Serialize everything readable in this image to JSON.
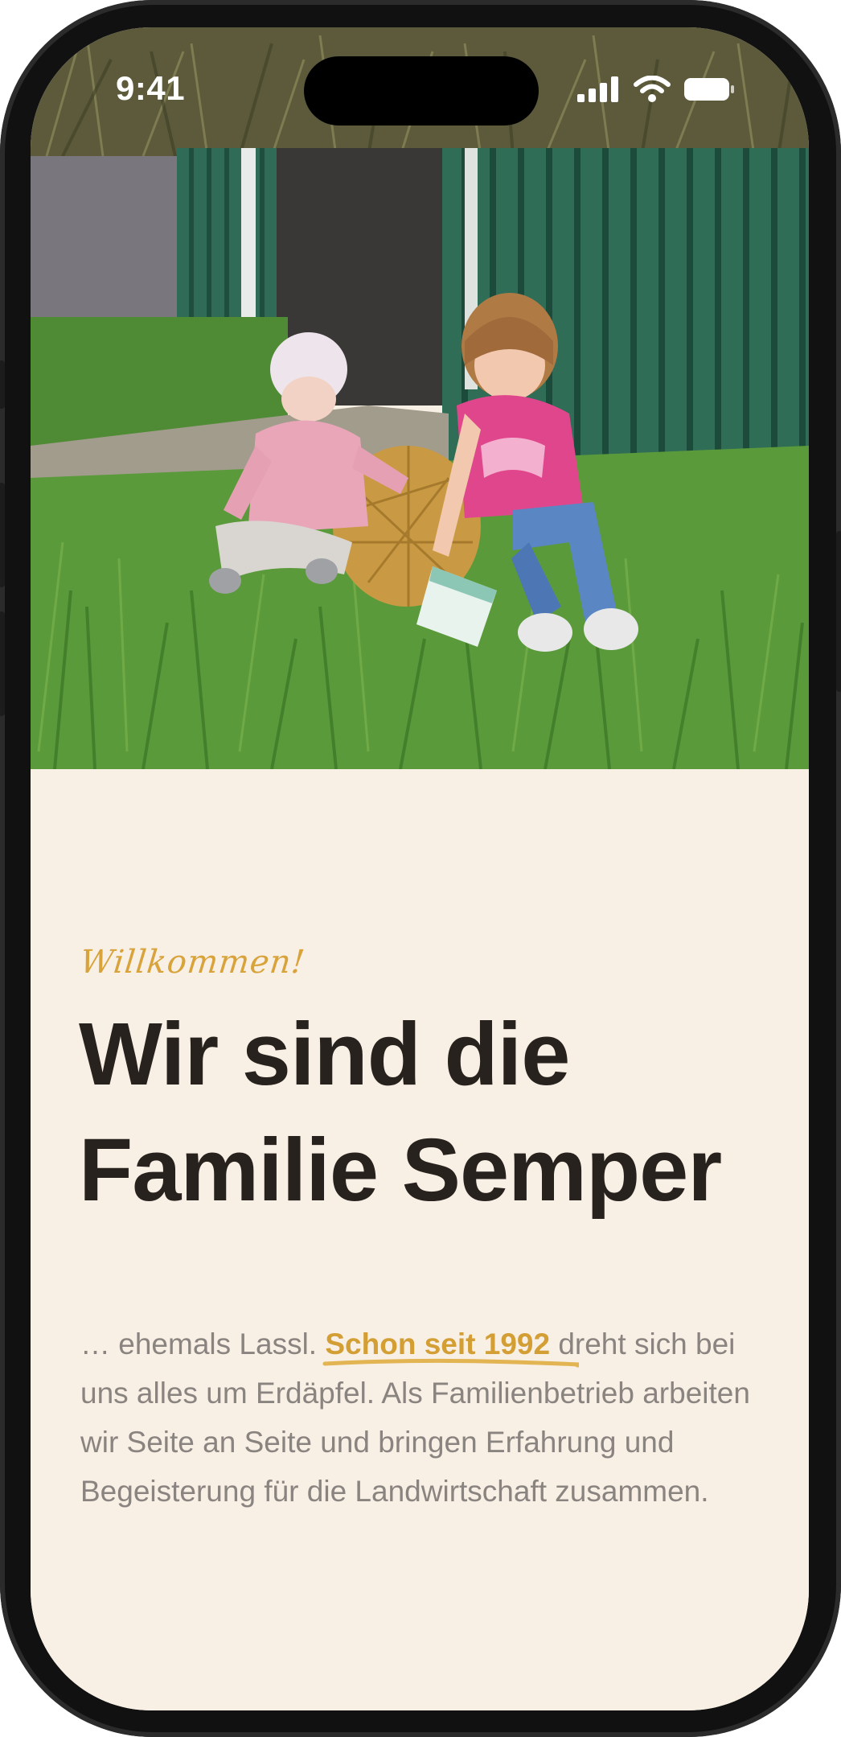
{
  "status_bar": {
    "time": "9:41",
    "icons": [
      "cellular-signal-icon",
      "wifi-icon",
      "battery-icon"
    ]
  },
  "hero": {
    "image": "photo-two-children-sitting-on-grass-with-potato-sack"
  },
  "welcome": {
    "eyebrow": "Willkommen!",
    "headline": "Wir sind die Familie Semper",
    "body_before": "… ehemals Lassl. ",
    "body_highlight": "Schon seit 1992",
    "body_after": "  dreht sich bei uns alles um Erdäpfel. Als Familienbetrieb arbeiten wir Seite an Seite und bringen Erfahrung und Begeisterung für die Landwirtschaft zusammen."
  },
  "colors": {
    "accent": "#d39e34",
    "background": "#f8efe5",
    "headline": "#28221f",
    "body": "#8a8480"
  }
}
